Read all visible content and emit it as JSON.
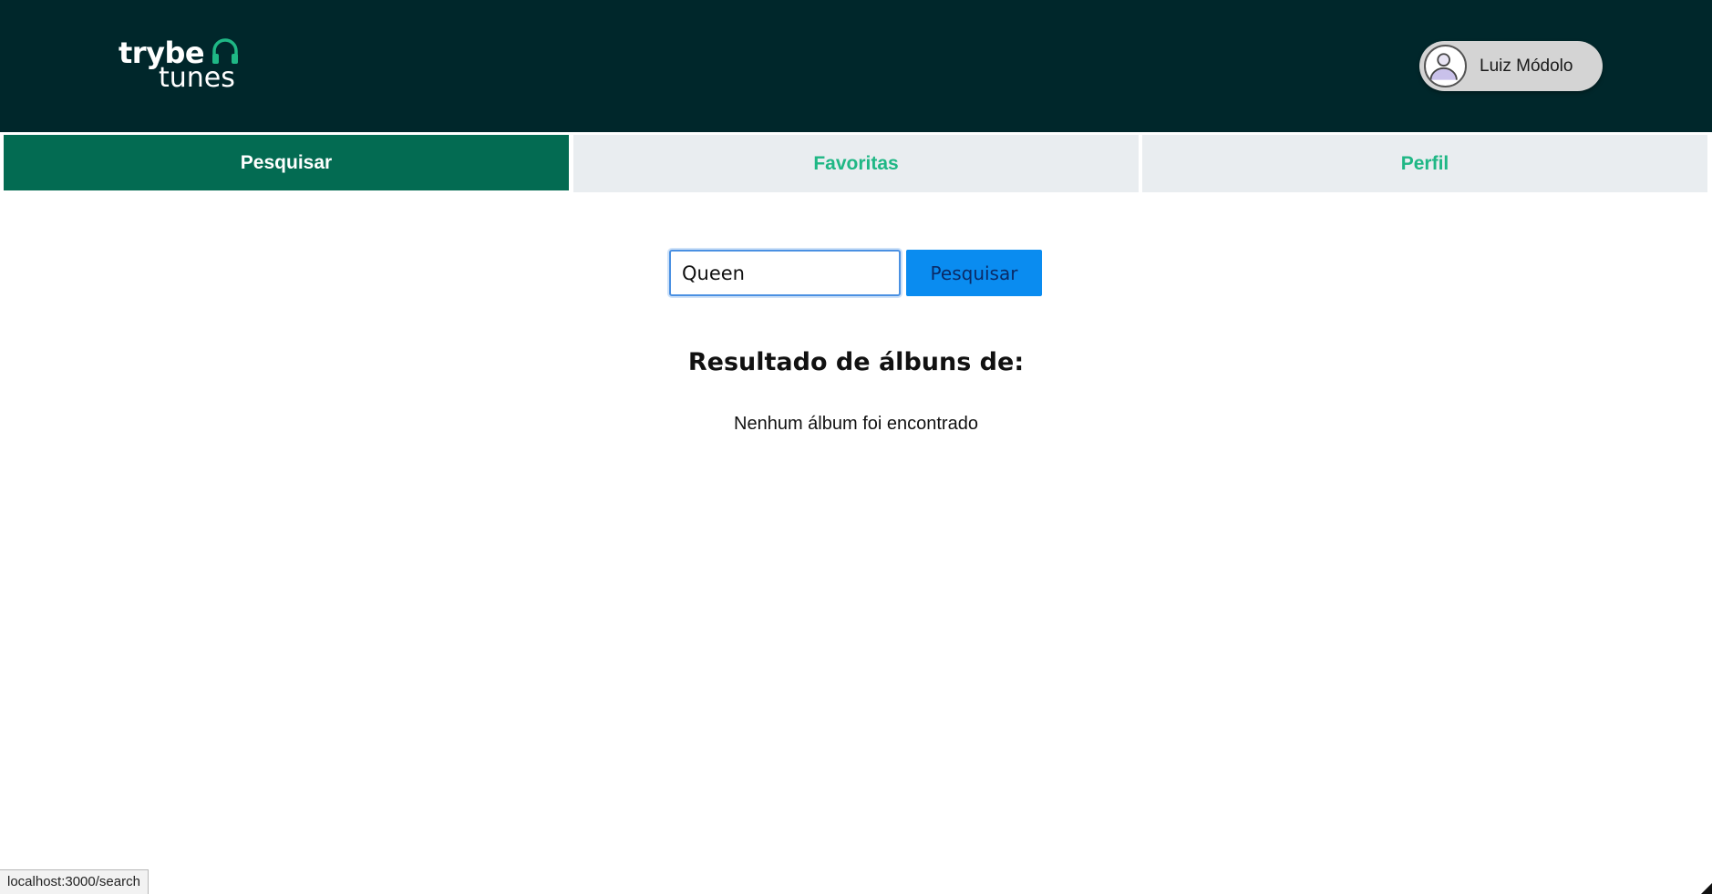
{
  "app": {
    "logo_top": "trybe",
    "logo_bottom": "tunes",
    "brand_color": "#036b52",
    "accent_color": "#1fb785",
    "header_color": "#00272b"
  },
  "user": {
    "name": "Luiz Módolo",
    "avatar_icon": "user-avatar-icon"
  },
  "nav": {
    "tabs": [
      {
        "label": "Pesquisar",
        "active": true
      },
      {
        "label": "Favoritas",
        "active": false
      },
      {
        "label": "Perfil",
        "active": false
      }
    ]
  },
  "search": {
    "value": "Queen",
    "button_label": "Pesquisar"
  },
  "results": {
    "title": "Resultado de álbuns de:",
    "empty_message": "Nenhum álbum foi encontrado"
  },
  "status_bar": {
    "url": "localhost:3000/search"
  }
}
